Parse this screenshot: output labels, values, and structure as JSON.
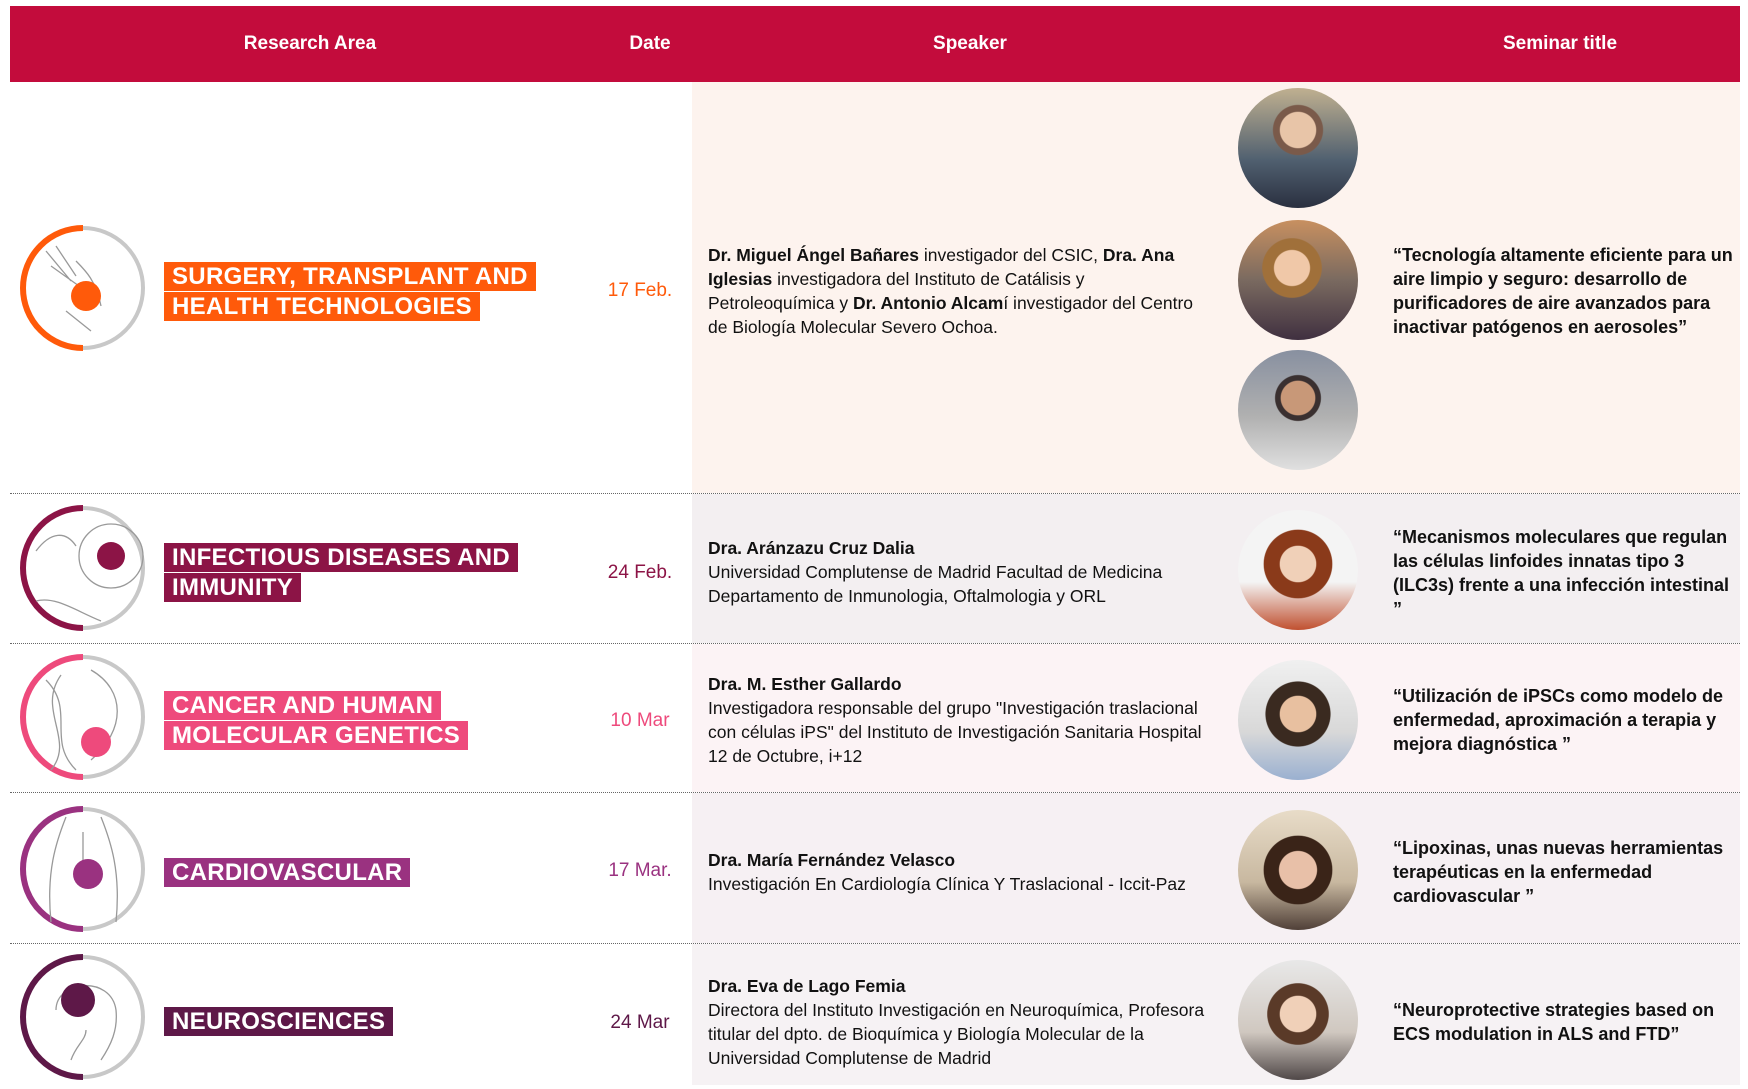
{
  "header": {
    "research_area": "Research Area",
    "date": "Date",
    "speaker": "Speaker",
    "seminar_title": "Seminar title"
  },
  "rows": [
    {
      "area_line1": "SURGERY, TRANSPLANT AND",
      "area_line2": "HEALTH TECHNOLOGIES",
      "color": "#ff5a0a",
      "date": "17 Feb.",
      "speaker_parts": [
        "Dr. Miguel Ángel Bañares",
        " investigador del CSIC, ",
        "Dra. Ana Iglesias",
        " investigadora del Instituto de Catálisis y Petroleoquímica y ",
        "Dr. Antonio Alcam",
        "í investigador del Centro de Biología Molecular Severo Ochoa."
      ],
      "seminar_title": "“Tecnología altamente eficiente para un aire limpio y seguro: desarrollo de purificadores de aire avanzados para inactivar patógenos en aerosoles”"
    },
    {
      "area_line1": "INFECTIOUS DISEASES AND",
      "area_line2": "IMMUNITY",
      "color": "#8c1446",
      "date": "24 Feb.",
      "speaker_name": "Dra. Aránzazu Cruz Dalia",
      "speaker_info": "Universidad Complutense de Madrid Facultad de Medicina Departamento de Inmunologia, Oftalmologia y ORL",
      "seminar_title": "“Mecanismos moleculares que regulan las células linfoides innatas tipo 3 (ILC3s) frente a una infección intestinal ”"
    },
    {
      "area_line1": "CANCER AND HUMAN",
      "area_line2": "MOLECULAR GENETICS",
      "color": "#ee4a7c",
      "date": "10 Mar",
      "speaker_name": "Dra. M. Esther Gallardo",
      "speaker_info": "Investigadora responsable del grupo \"Investigación traslacional con células iPS\" del Instituto de Investigación Sanitaria Hospital 12 de Octubre, i+12",
      "seminar_title": "“Utilización de iPSCs como modelo de enfermedad, aproximación a terapia y mejora diagnóstica ”"
    },
    {
      "area_line1": "CARDIOVASCULAR",
      "area_line2": "",
      "color": "#9a3280",
      "date": "17 Mar.",
      "speaker_name": "Dra. María Fernández Velasco",
      "speaker_info": "Investigación En Cardiología Clínica Y Traslacional - Iccit-Paz",
      "seminar_title": "“Lipoxinas, unas nuevas herramientas terapéuticas en la enfermedad cardiovascular ”"
    },
    {
      "area_line1": "NEUROSCIENCES",
      "area_line2": "",
      "color": "#5e1848",
      "date": "24 Mar",
      "speaker_name": "Dra. Eva de Lago Femia",
      "speaker_info": "Directora del Instituto Investigación en Neuroquímica, Profesora titular del dpto. de Bioquímica y Biología Molecular de la Universidad Complutense de Madrid",
      "seminar_title": "“Neuroprotective strategies based on ECS modulation in ALS and FTD”"
    }
  ]
}
